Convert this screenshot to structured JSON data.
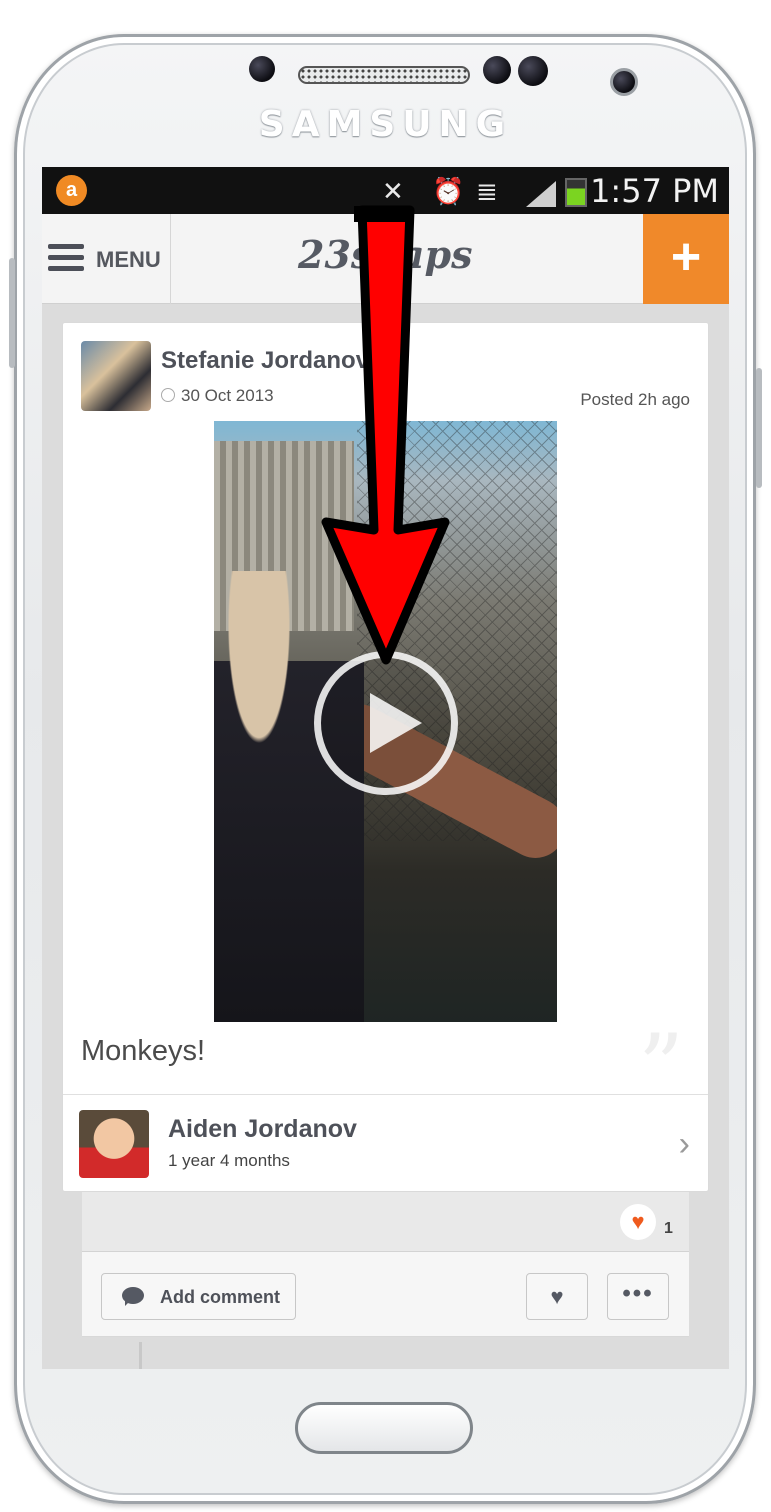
{
  "device": {
    "brand": "SAMSUNG"
  },
  "status_bar": {
    "time": "1:57 PM",
    "app_icon": "circle-a-icon",
    "icons": [
      "notifications-muted-icon",
      "alarm-icon",
      "wifi-icon",
      "signal-icon",
      "battery-icon"
    ]
  },
  "header": {
    "menu_label": "MENU",
    "logo": "23snaps",
    "add_label": "+"
  },
  "post": {
    "author": "Stefanie Jordanov",
    "date": "30 Oct 2013",
    "posted": "Posted 2h ago",
    "caption": "Monkeys!",
    "media_type": "video",
    "quote_glyph": "”",
    "child": {
      "name": "Aiden Jordanov",
      "age": "1 year 4 months",
      "chevron": "›"
    },
    "likes": {
      "heart": "♥",
      "count": "1"
    },
    "actions": {
      "comment_label": "Add comment",
      "like_glyph": "♥",
      "more_glyph": "•••"
    }
  },
  "colors": {
    "accent": "#f0892a",
    "heart": "#ef5b1e",
    "annotation_arrow": "#ff0000"
  }
}
